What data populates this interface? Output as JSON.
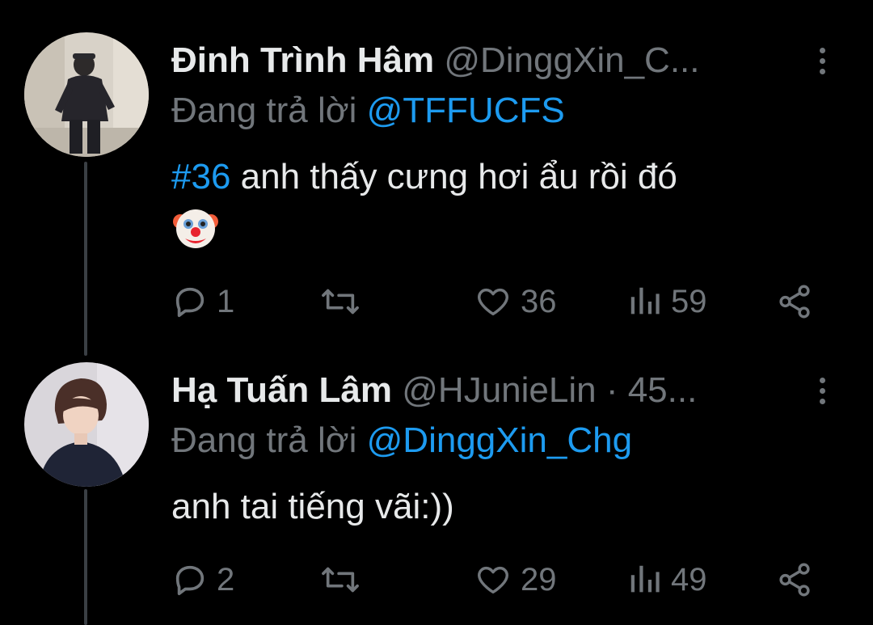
{
  "tweets": [
    {
      "display_name": "Đinh Trình Hâm",
      "handle_meta": "@DinggXin_C...",
      "reply_prefix": "Đang trả lời",
      "reply_to": "@TFFUCFS",
      "hashtag": "#36",
      "text": "anh thấy cưng hơi ẩu rồi đó",
      "emoji": "clown-face-icon",
      "replies": "1",
      "retweets": "",
      "likes": "36",
      "views": "59"
    },
    {
      "display_name": "Hạ Tuấn Lâm",
      "handle_meta": "@HJunieLin · 45...",
      "reply_prefix": "Đang trả lời",
      "reply_to": "@DinggXin_Chg",
      "text": "anh tai tiếng vãi:))",
      "replies": "2",
      "retweets": "",
      "likes": "29",
      "views": "49"
    }
  ],
  "colors": {
    "background": "#000000",
    "text_primary": "#e7e9ea",
    "text_secondary": "#71767b",
    "accent_link": "#1d9bf0",
    "thread_line": "#3a3f44"
  }
}
